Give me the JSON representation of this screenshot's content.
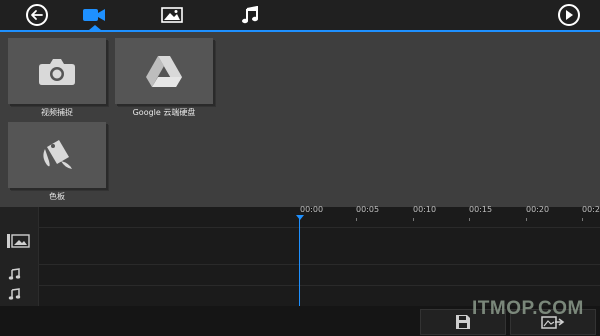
{
  "toolbar": {
    "back_icon": "back-arrow-icon",
    "tabs": [
      {
        "icon": "video-camera-icon",
        "active": true
      },
      {
        "icon": "photo-icon",
        "active": false
      },
      {
        "icon": "music-note-icon",
        "active": false
      }
    ],
    "play_icon": "play-icon"
  },
  "media": {
    "items": [
      {
        "label": "视频捕捉",
        "icon": "camera-icon"
      },
      {
        "label": "Google 云端硬盘",
        "icon": "google-drive-icon"
      },
      {
        "label": "色板",
        "icon": "paint-bucket-icon"
      }
    ]
  },
  "timeline": {
    "ticks": [
      "00:00",
      "00:05",
      "00:10",
      "00:15",
      "00:20",
      "00:2"
    ],
    "tracks": [
      "video-track-icon",
      "audio-track-1-icon",
      "audio-track-2-icon"
    ]
  },
  "bottom": {
    "save_icon": "save-icon",
    "export_icon": "export-icon"
  },
  "watermark": "ITMOP.COM",
  "colors": {
    "accent": "#1e90ff",
    "topbar": "#202020",
    "panel": "#3e3e3e",
    "timeline": "#1b1b1b"
  }
}
